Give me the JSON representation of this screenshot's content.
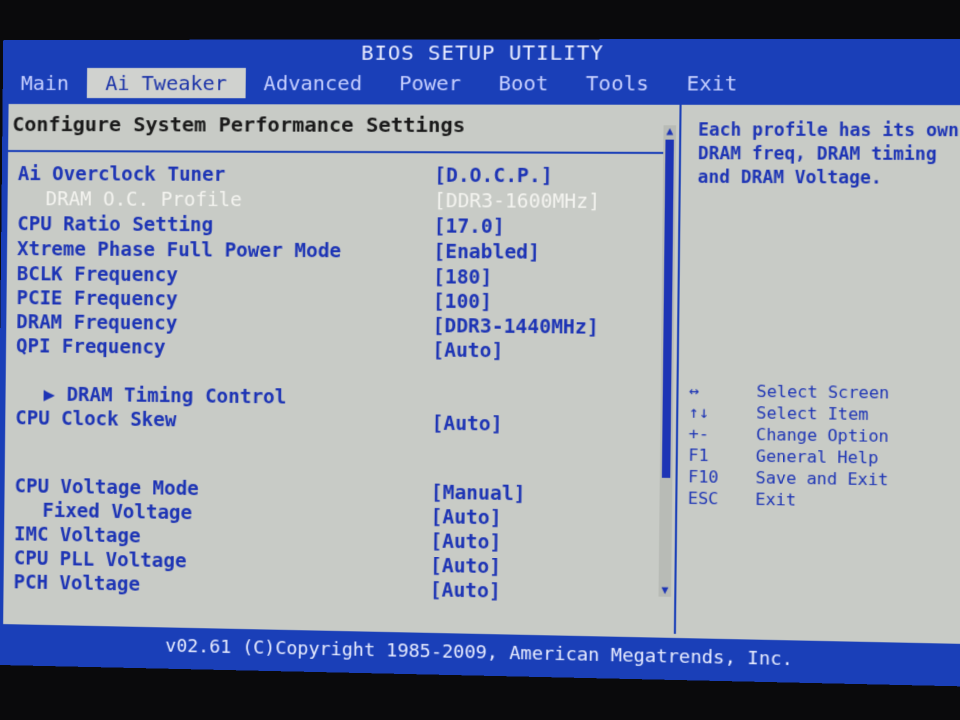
{
  "app": {
    "title": "BIOS SETUP UTILITY"
  },
  "menu": {
    "items": [
      {
        "label": "Main"
      },
      {
        "label": "Ai Tweaker"
      },
      {
        "label": "Advanced"
      },
      {
        "label": "Power"
      },
      {
        "label": "Boot"
      },
      {
        "label": "Tools"
      },
      {
        "label": "Exit"
      }
    ],
    "active_index": 1
  },
  "main": {
    "title": "Configure System Performance Settings",
    "settings": [
      {
        "label": "Ai Overclock Tuner",
        "value": "[D.O.C.P.]"
      },
      {
        "label": "DRAM O.C. Profile",
        "value": "[DDR3-1600MHz]"
      },
      {
        "label": "CPU Ratio Setting",
        "value": "[17.0]"
      },
      {
        "label": "Xtreme Phase Full Power Mode",
        "value": "[Enabled]"
      },
      {
        "label": "BCLK Frequency",
        "value": "[180]"
      },
      {
        "label": "PCIE Frequency",
        "value": "[100]"
      },
      {
        "label": "DRAM Frequency",
        "value": "[DDR3-1440MHz]"
      },
      {
        "label": "QPI Frequency",
        "value": "[Auto]"
      },
      {
        "label": "▶ DRAM Timing Control",
        "value": ""
      },
      {
        "label": "CPU Clock Skew",
        "value": "[Auto]"
      },
      {
        "label": "CPU Voltage Mode",
        "value": "[Manual]"
      },
      {
        "label": "Fixed Voltage",
        "value": "[Auto]"
      },
      {
        "label": "IMC Voltage",
        "value": "[Auto]"
      },
      {
        "label": "CPU PLL Voltage",
        "value": "[Auto]"
      },
      {
        "label": "PCH Voltage",
        "value": "[Auto]"
      }
    ]
  },
  "scrollbar": {
    "up_glyph": "▲",
    "down_glyph": "▼"
  },
  "help": {
    "text": "Each profile has its own DRAM freq, DRAM timing and DRAM Voltage.",
    "keys": [
      {
        "key": "↔",
        "desc": "Select Screen"
      },
      {
        "key": "↑↓",
        "desc": "Select Item"
      },
      {
        "key": "+-",
        "desc": "Change Option"
      },
      {
        "key": "F1",
        "desc": "General Help"
      },
      {
        "key": "F10",
        "desc": "Save and Exit"
      },
      {
        "key": "ESC",
        "desc": "Exit"
      }
    ]
  },
  "footer": {
    "text": "v02.61 (C)Copyright 1985-2009, American Megatrends, Inc."
  },
  "colors": {
    "frame_blue": "#1a3fb8",
    "panel_gray": "#c8cbc6",
    "text_blue": "#1d34b5",
    "highlight_white": "#f4f4f0"
  }
}
